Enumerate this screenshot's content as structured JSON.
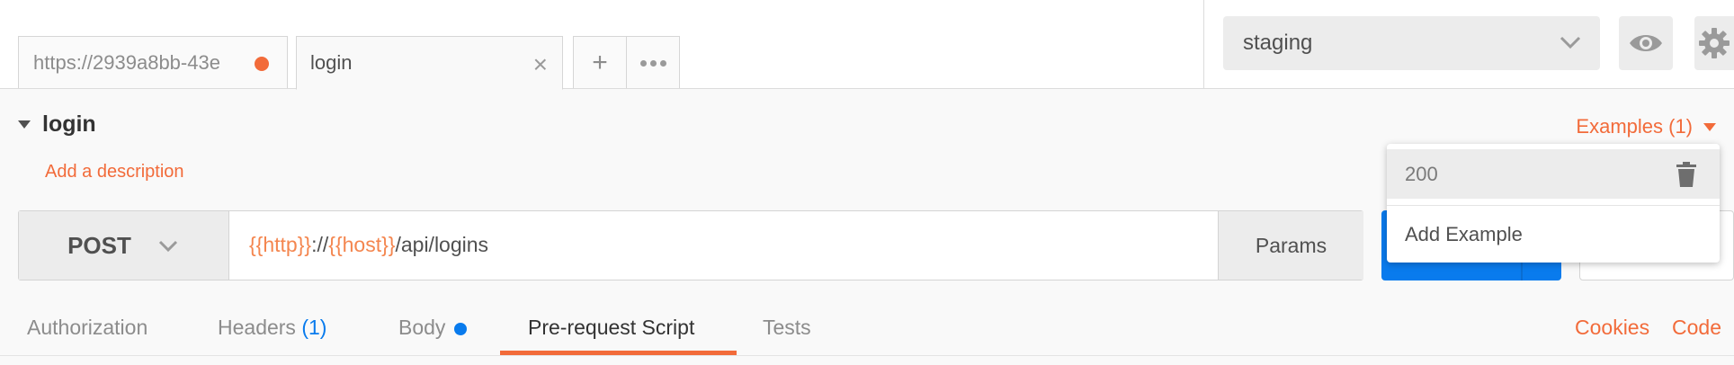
{
  "tabs": [
    {
      "label": "https://2939a8bb-43e",
      "unsaved": true
    },
    {
      "label": "login",
      "closable": true
    }
  ],
  "environment": {
    "selected": "staging"
  },
  "request": {
    "name": "login",
    "add_description": "Add a description",
    "examples_label": "Examples (1)",
    "method": "POST",
    "url_parts": {
      "var1": "{{http}}",
      "sep": "://",
      "var2": "{{host}}",
      "path": "/api/logins"
    },
    "params_label": "Params"
  },
  "examples_dropdown": {
    "items": [
      "200"
    ],
    "add_label": "Add Example"
  },
  "subtabs": {
    "authorization": "Authorization",
    "headers": "Headers",
    "headers_count": "(1)",
    "body": "Body",
    "prerequest": "Pre-request Script",
    "tests": "Tests",
    "active": "Pre-request Script"
  },
  "links": {
    "cookies": "Cookies",
    "code": "Code"
  },
  "colors": {
    "accent_orange": "#f26b3a",
    "accent_blue": "#097bed",
    "variable_orange": "#f4864f"
  },
  "icons": {
    "add": "plus-icon",
    "more": "ellipsis-icon",
    "close": "close-icon",
    "env_chevron": "chevron-down-icon",
    "eye": "eye-icon",
    "settings": "gear-icon",
    "trash": "trash-icon"
  }
}
